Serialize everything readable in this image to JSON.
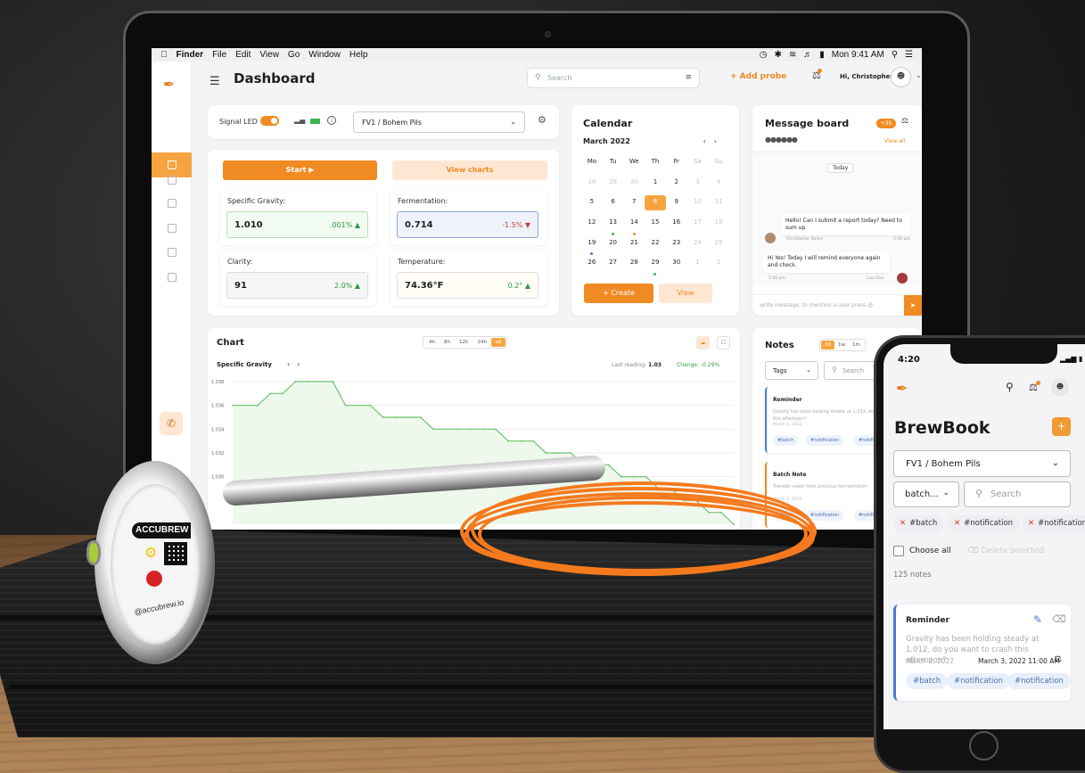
{
  "menubar": {
    "app": "Finder",
    "items": [
      "File",
      "Edit",
      "View",
      "Go",
      "Window",
      "Help"
    ],
    "clock": "Mon 9:41 AM"
  },
  "header": {
    "title": "Dashboard",
    "search_placeholder": "Search",
    "add_probe": "+ Add probe",
    "greeting": "Hi, Christopher"
  },
  "signal": {
    "label": "Signal LED",
    "probe": "FV1 / Bohem Pils"
  },
  "sensors": {
    "start_label": "Start ▶",
    "view_charts_label": "View charts",
    "metrics": [
      {
        "label": "Specific Gravity:",
        "value": "1.010",
        "change": ".001% ▲"
      },
      {
        "label": "Fermentation:",
        "value": "0.714",
        "change": "-1.5% ▼"
      },
      {
        "label": "Clarity:",
        "value": "91",
        "change": "2.0% ▲"
      },
      {
        "label": "Temperature:",
        "value": "74.36°F",
        "change": "0.2° ▲"
      }
    ]
  },
  "calendar": {
    "title": "Calendar",
    "month": "March 2022",
    "weekdays": [
      "Mo",
      "Tu",
      "We",
      "Th",
      "Fr",
      "Sa",
      "Su"
    ],
    "days": [
      "28",
      "29",
      "30",
      "1",
      "2",
      "3",
      "4",
      "5",
      "6",
      "7",
      "8",
      "9",
      "10",
      "11",
      "12",
      "13",
      "14",
      "15",
      "16",
      "17",
      "18",
      "19",
      "20",
      "21",
      "22",
      "23",
      "24",
      "25",
      "26",
      "27",
      "28",
      "29",
      "30",
      "1",
      "2"
    ],
    "today": "8",
    "create_label": "+ Create",
    "view_label": "View"
  },
  "messages": {
    "title": "Message board",
    "badge": "+30",
    "view_all": "View all",
    "today_label": "Today",
    "bubbles": [
      {
        "text": "Hello! Can I submit a report today? Need to sum up",
        "author": "Christopher Bailey",
        "time": "5:56 pm"
      },
      {
        "text": "Hi Yes! Today I will remind everyone again and check.",
        "author": "Liza Doe",
        "time": "5:56 pm"
      }
    ],
    "input_placeholder": "write message, to mention a user press @"
  },
  "chart": {
    "title": "Chart",
    "ranges": [
      "4h",
      "8h",
      "12h",
      "24h",
      "all"
    ],
    "selected_range": "all",
    "series_name": "Specific Gravity",
    "last_reading_label": "Last reading:",
    "last_reading_value": "1.03",
    "change_label": "Change: -0.29%"
  },
  "chart_data": {
    "type": "line",
    "title": "Specific Gravity",
    "x": [
      0,
      1,
      2,
      3,
      4,
      5,
      6,
      7,
      8,
      9,
      10,
      11,
      12,
      13,
      14,
      15,
      16,
      17,
      18,
      19,
      20,
      21,
      22,
      23,
      24,
      25,
      26,
      27,
      28,
      29,
      30,
      31,
      32,
      33,
      34,
      35,
      36,
      37,
      38,
      39,
      40
    ],
    "values": [
      1.036,
      1.036,
      1.036,
      1.037,
      1.037,
      1.038,
      1.038,
      1.038,
      1.038,
      1.036,
      1.036,
      1.036,
      1.035,
      1.035,
      1.035,
      1.035,
      1.034,
      1.034,
      1.034,
      1.034,
      1.034,
      1.034,
      1.033,
      1.033,
      1.033,
      1.032,
      1.032,
      1.032,
      1.031,
      1.031,
      1.031,
      1.03,
      1.03,
      1.03,
      1.029,
      1.029,
      1.028,
      1.028,
      1.027,
      1.027,
      1.026
    ],
    "ylim": [
      1.026,
      1.038
    ],
    "yticks": [
      "1.038",
      "1.036",
      "1.034",
      "1.032",
      "1.030"
    ],
    "grid": true
  },
  "notes": {
    "title": "Notes",
    "tabs": [
      "3d",
      "1w",
      "1m"
    ],
    "selected_tab": "3d",
    "tags_label": "Tags",
    "search_placeholder": "Search",
    "items": [
      {
        "title": "Reminder",
        "body": "Gravity has been holding steady at 1.012, do you want to crash this afternoon?",
        "date": "March 2, 2022",
        "chips": [
          "#batch",
          "#notification",
          "#notification"
        ]
      },
      {
        "title": "Batch Note",
        "body": "Transfer yeast from previous fermentation",
        "date": "March 2, 2022",
        "chips": [
          "#batch",
          "#notification",
          "#notification"
        ]
      }
    ]
  },
  "phone": {
    "time": "4:20",
    "title": "BrewBook",
    "probe": "FV1 / Bohem Pils",
    "filter": "batch...",
    "search_placeholder": "Search",
    "chips": [
      "#batch",
      "#notification",
      "#notification"
    ],
    "choose_all": "Choose all",
    "delete_selected": "Delete selected",
    "count": "125 notes",
    "note": {
      "title": "Reminder",
      "body": "Gravity has been holding steady at 1.012, do you want to crash this afternoon?",
      "date": "March 2, 2022",
      "reminder": "March 3, 2022 11:00 AM",
      "chips": [
        "#batch",
        "#notification",
        "#notification"
      ]
    }
  },
  "probe_device": {
    "brand": "ACCUBREW",
    "url": "@accubrew.io"
  },
  "colors": {
    "accent": "#f08a22",
    "accent_light": "#fde7d3",
    "up": "#2e9a3c",
    "down": "#d23a3a",
    "note_blue": "#4a7bd0"
  }
}
